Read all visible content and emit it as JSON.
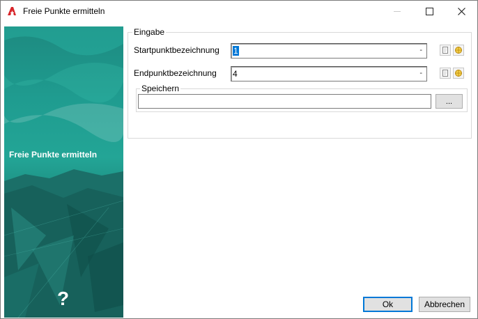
{
  "window": {
    "title": "Freie Punkte ermitteln",
    "icon": "autocad-a-icon",
    "controls": [
      "minimize-icon",
      "maximize-icon",
      "close-icon"
    ]
  },
  "banner": {
    "title": "Freie Punkte ermitteln",
    "help_label": "?"
  },
  "eingabe": {
    "legend": "Eingabe",
    "start_label": "Startpunktbezeichnung",
    "start_value": "1",
    "end_label": "Endpunktbezeichnung",
    "end_value": "4",
    "dropdown_marker": "-"
  },
  "speichern": {
    "legend": "Speichern",
    "path_value": "",
    "browse_label": "..."
  },
  "buttons": {
    "ok": "Ok",
    "cancel": "Abbrechen"
  },
  "colors": {
    "banner": "#1f9c90",
    "accent": "#0078d7",
    "icon_red": "#d8262b"
  }
}
